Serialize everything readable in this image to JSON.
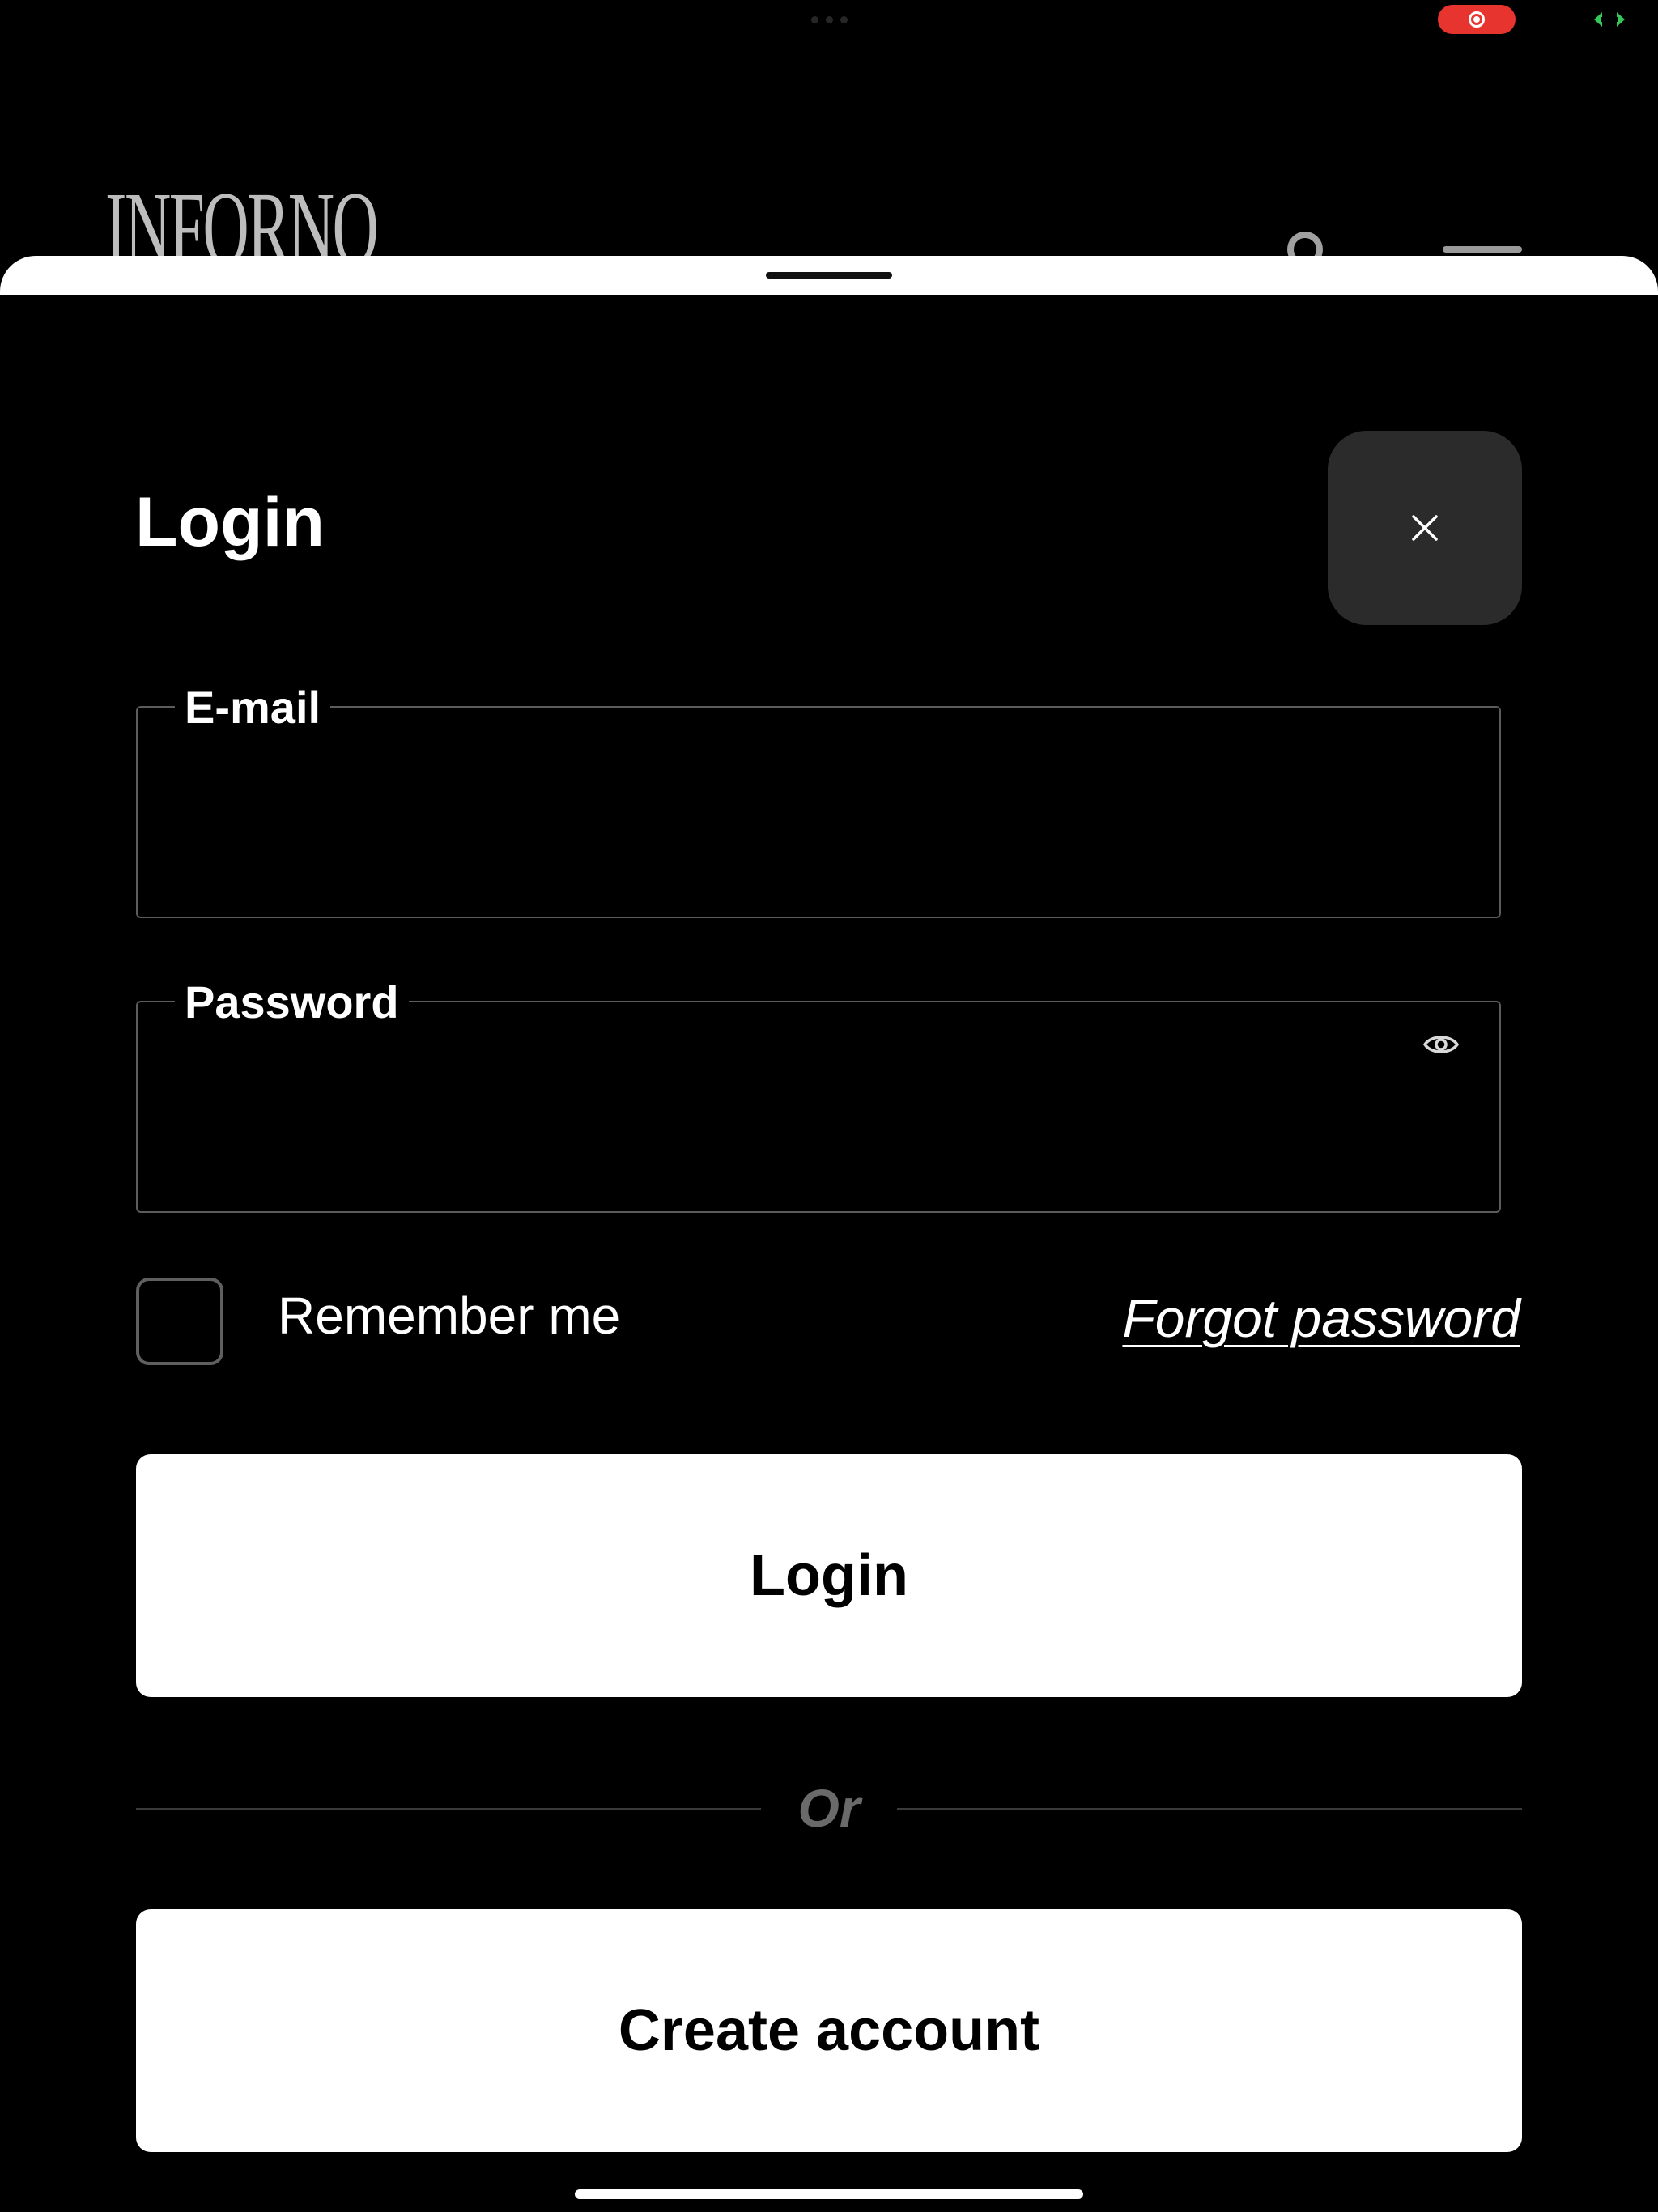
{
  "status_bar": {
    "recording_icon": "record-icon",
    "expand_icon": "expand-arrows-icon"
  },
  "background_app": {
    "logo_text": "INFORNO",
    "search_icon": "search-icon",
    "menu_icon": "menu-icon"
  },
  "login_sheet": {
    "title": "Login",
    "close_icon": "close-icon",
    "email": {
      "label": "E-mail",
      "value": "",
      "placeholder": ""
    },
    "password": {
      "label": "Password",
      "value": "",
      "placeholder": "",
      "toggle_icon": "eye-icon"
    },
    "remember_me": {
      "label": "Remember me",
      "checked": false
    },
    "forgot_password_label": "Forgot password",
    "login_button_label": "Login",
    "divider_text": "Or",
    "create_account_label": "Create account"
  },
  "colors": {
    "background": "#000000",
    "surface": "#2b2b2b",
    "border": "#5c5c5c",
    "text": "#ffffff",
    "muted_text": "#6a6a6a",
    "recording": "#e8342e",
    "expand_icon": "#34c759"
  }
}
